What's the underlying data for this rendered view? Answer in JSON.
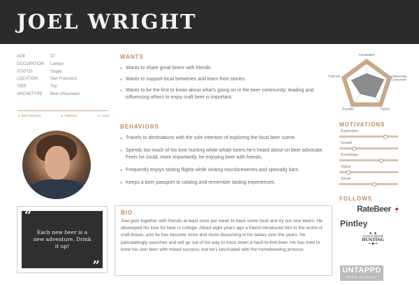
{
  "persona": {
    "name": "JOEL WRIGHT"
  },
  "info": [
    {
      "key": "AGE",
      "value": "37"
    },
    {
      "key": "OCCUPATION",
      "value": "Lawyer"
    },
    {
      "key": "STATUS",
      "value": "Single"
    },
    {
      "key": "LOCATION",
      "value": "San Francisco"
    },
    {
      "key": "TIER",
      "value": "Top"
    },
    {
      "key": "ARCHETYPE",
      "value": "Beer Aficionado"
    }
  ],
  "tags": [
    "Beer-targeted",
    "Authentic",
    "Avoid"
  ],
  "quote": {
    "open": "“",
    "text": "Each new beer is a new adventure. Drink it up!",
    "close": "”"
  },
  "wants": {
    "title": "WANTS",
    "items": [
      "Wants to share great beers with friends.",
      "Wants to support local breweries and learn their stories.",
      "Wants to be the first to know about what’s going on in the beer community; leading and influencing others to enjoy craft beer is important."
    ]
  },
  "behaviors": {
    "title": "BEHAVIORS",
    "items": [
      "Travels to destinations with the sole intention of exploring the local beer scene.",
      "Spends too much of his time hunting white whale beers he’s heard about on beer advocate. Feels he could, more importantly, be enjoying beer with friends.",
      "Frequently enjoys tasting flights while visiting microbreweries and specialty bars.",
      "Keeps a beer passport to catalog and remember tasting experiences."
    ]
  },
  "bio": {
    "title": "BIO",
    "text": "Joel gets together with friends at least once per week to have some food and try out new beers. He developed his love for beer in college. About eight years ago a friend introduced him to the world of craft brews, and he has become more and more discerning in his tastes over the years. He painstakingly searches and will go out of his way to track down a hard-to-find beer. He has tried to brew his own beer with mixed success, but he’s fascinated with the homebrewing process."
  },
  "radar": {
    "axes": [
      "Trendsetter",
      "Discerning Consumer",
      "Patron",
      "Reveller",
      "Explorer"
    ],
    "axis_line2": [
      "",
      "Consumer",
      "",
      "",
      ""
    ],
    "axis_line1": [
      "Trendsetter",
      "Discerning",
      "Patron",
      "Reveller",
      "Explorer"
    ],
    "values": [
      0.55,
      0.85,
      0.7,
      0.5,
      0.75
    ],
    "colors": {
      "ring": "#c9a98a",
      "fill": "#8c8c8c"
    }
  },
  "motivations": {
    "title": "MOTIVATIONS",
    "items": [
      {
        "label": "Exploration",
        "value": 0.78
      },
      {
        "label": "Growth",
        "value": 0.25
      },
      {
        "label": "Knowledge",
        "value": 0.72
      },
      {
        "label": "Status",
        "value": 0.15
      },
      {
        "label": "Social",
        "value": 0.6
      }
    ]
  },
  "follows": {
    "title": "FOLLOWS",
    "ratebeer": "RateBeer",
    "pintley": "Pintley",
    "gbh_top": "GOOD BEER",
    "gbh_mid": "HUNTING",
    "untappd": "UNTAPPD",
    "untappd_sub": "DRINK SOCIALLY"
  },
  "colors": {
    "accent": "#c08a5b",
    "header_bg": "#2b2b2b"
  }
}
